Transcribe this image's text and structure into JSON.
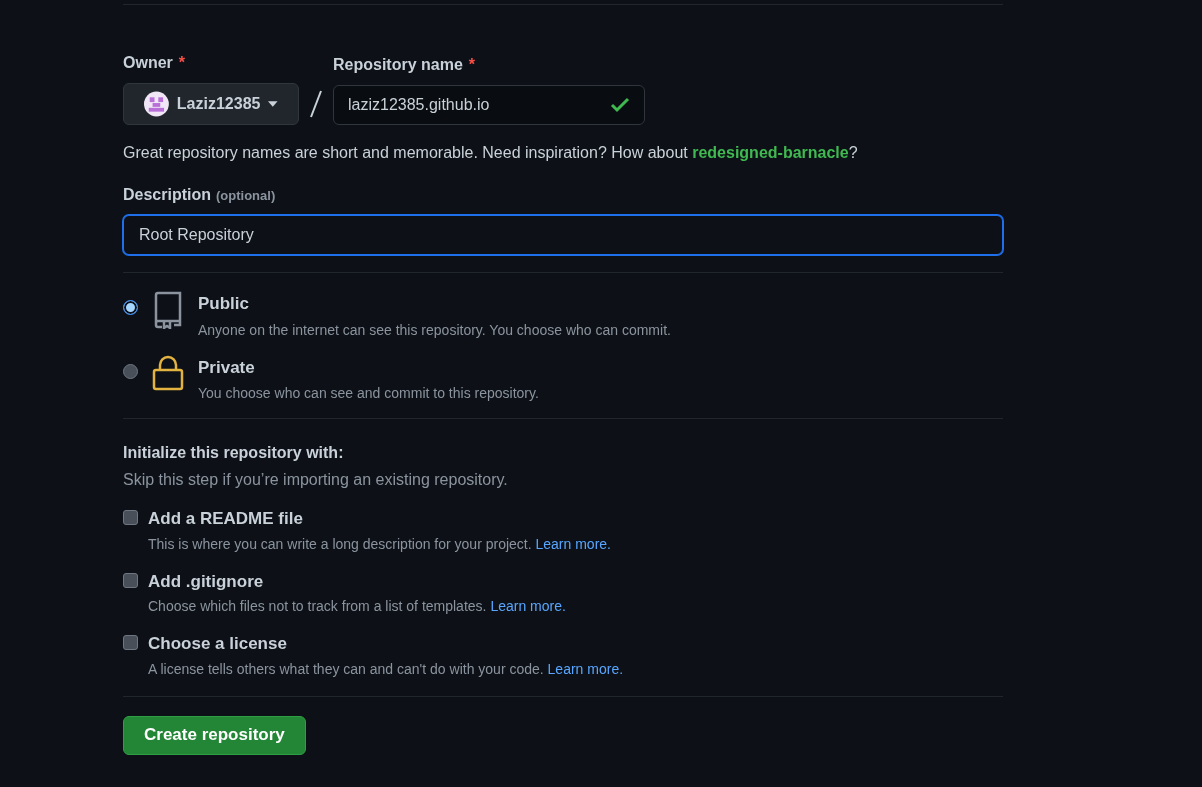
{
  "owner": {
    "label": "Owner",
    "required_mark": "*",
    "value": "Laziz12385"
  },
  "repository_name": {
    "label": "Repository name",
    "required_mark": "*",
    "value": "laziz12385.github.io",
    "valid": true
  },
  "name_hint": {
    "text": "Great repository names are short and memorable. Need inspiration? How about ",
    "suggestion": "redesigned-barnacle",
    "end": "?"
  },
  "description": {
    "label": "Description",
    "optional": "(optional)",
    "value": "Root Repository",
    "focused": true
  },
  "visibility": [
    {
      "kind": "public",
      "title": "Public",
      "text": "Anyone on the internet can see this repository. You choose who can commit.",
      "selected": true
    },
    {
      "kind": "private",
      "title": "Private",
      "text": "You choose who can see and commit to this repository.",
      "selected": false
    }
  ],
  "initialize": {
    "title": "Initialize this repository with:",
    "subtitle": "Skip this step if you’re importing an existing repository.",
    "options": [
      {
        "title": "Add a README file",
        "text": "This is where you can write a long description for your project.",
        "link": "Learn more.",
        "checked": false
      },
      {
        "title": "Add .gitignore",
        "text": "Choose which files not to track from a list of templates.",
        "link": "Learn more.",
        "checked": false
      },
      {
        "title": "Choose a license",
        "text": "A license tells others what they can and can't do with your code.",
        "link": "Learn more.",
        "checked": false
      }
    ]
  },
  "submit": {
    "label": "Create repository"
  }
}
